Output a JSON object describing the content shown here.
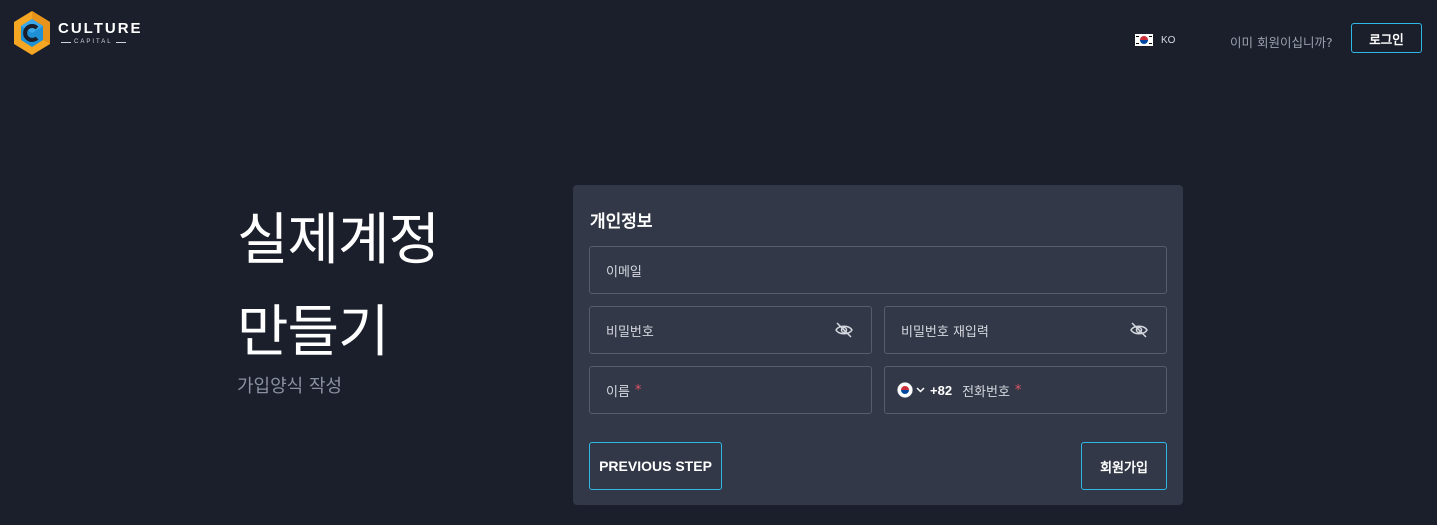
{
  "brand": {
    "name": "CULTURE",
    "tagline": "CAPITAL"
  },
  "header": {
    "language_code": "KO",
    "login_question": "이미 회원이십니까?",
    "login_button": "로그인"
  },
  "hero": {
    "title_line1": "실제계정",
    "title_line2": "만들기",
    "subtitle": "가입양식 작성"
  },
  "form": {
    "section_title": "개인정보",
    "email_label": "이메일",
    "password_label": "비밀번호",
    "password_confirm_label": "비밀번호 재입력",
    "name_label": "이름",
    "phone_prefix": "+82",
    "phone_label": "전화번호",
    "required_mark": "*",
    "previous_button": "PREVIOUS STEP",
    "signup_button": "회원가입"
  },
  "colors": {
    "background": "#1b1f2c",
    "card": "#323847",
    "accent": "#2fb8e6",
    "required": "#e05564",
    "logo_orange": "#f5a623",
    "logo_blue": "#1e90d6"
  },
  "icons": {
    "logo": "culture-capital-hexagon-logo",
    "flag": "korea-flag-icon",
    "eye_slash": "eye-slash-icon",
    "chevron": "chevron-down-icon"
  }
}
